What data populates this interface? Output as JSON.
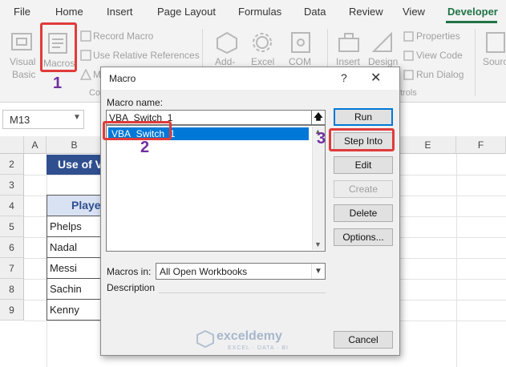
{
  "ribbon_tabs": [
    "File",
    "Home",
    "Insert",
    "Page Layout",
    "Formulas",
    "Data",
    "Review",
    "View",
    "Developer"
  ],
  "active_tab": "Developer",
  "ribbon": {
    "visual_basic_line1": "Visual",
    "visual_basic_line2": "Basic",
    "macros": "Macros",
    "record_macro": "Record Macro",
    "relative_refs": "Use Relative References",
    "macro_security_partial": "M",
    "code_group_partial": "Co",
    "addins_partial": "Add-",
    "excel_partial": "Excel",
    "com_partial": "COM",
    "insert": "Insert",
    "design": "Design",
    "properties": "Properties",
    "view_code": "View Code",
    "run_dialog": "Run Dialog",
    "controls_group_partial": "trols",
    "source_partial": "Sourc"
  },
  "namebox": {
    "value": "M13"
  },
  "columns": [
    "A",
    "B",
    "E",
    "F"
  ],
  "rows": [
    "2",
    "3",
    "4",
    "5",
    "6",
    "7",
    "8",
    "9"
  ],
  "sheet": {
    "title_partial": "Use of V",
    "player_header_partial": "Playe",
    "players": [
      "Phelps",
      "Nadal",
      "Messi",
      "Sachin",
      "Kenny"
    ]
  },
  "dialog": {
    "title": "Macro",
    "help": "?",
    "close": "✕",
    "macro_name_label": "Macro name:",
    "macro_name_value": "VBA_Switch_1",
    "list_items": [
      "VBA_Switch_1"
    ],
    "buttons": {
      "run": "Run",
      "step_into": "Step Into",
      "edit": "Edit",
      "create": "Create",
      "delete": "Delete",
      "options": "Options...",
      "cancel": "Cancel"
    },
    "macros_in_label": "Macros in:",
    "macros_in_value": "All Open Workbooks",
    "description_label": "Description"
  },
  "annotations": {
    "step1": "1",
    "step2": "2",
    "step3": "3"
  },
  "watermark": {
    "brand": "exceldemy",
    "sub": "EXCEL · DATA · BI"
  },
  "colors": {
    "accent": "#217346",
    "highlight_box": "#e03b3b",
    "step_number": "#7030a0",
    "selection": "#0078d7"
  }
}
